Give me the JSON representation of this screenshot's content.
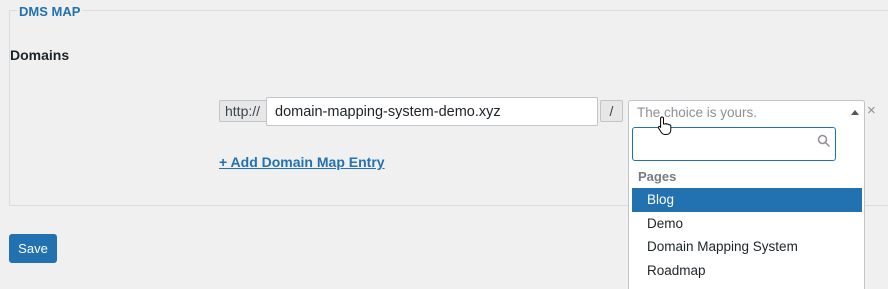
{
  "section": {
    "legend": "DMS MAP",
    "domains_label": "Domains"
  },
  "mapping": {
    "prefix": "http://",
    "domain_value": "domain-mapping-system-demo.xyz",
    "separator": "/",
    "select_placeholder": "The choice is yours.",
    "remove_symbol": "×"
  },
  "dropdown": {
    "search_value": "",
    "group_label": "Pages",
    "options": [
      "Blog",
      "Demo",
      "Domain Mapping System",
      "Roadmap"
    ],
    "highlighted_index": 0
  },
  "add_entry_label": "+ Add Domain Map Entry",
  "save_label": "Save",
  "icons": {
    "dropdown_arrow": "chevron-up-icon",
    "search": "search-icon",
    "cursor": "pointer-hand-icon",
    "remove": "close-icon"
  },
  "colors": {
    "accent": "#2271b1",
    "background": "#f0f0f1",
    "border": "#c3c4c7"
  }
}
